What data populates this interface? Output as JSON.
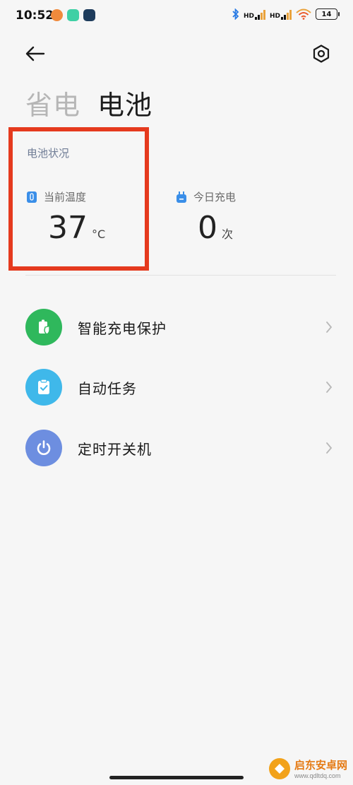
{
  "status_bar": {
    "time": "10:52",
    "left_icons": [
      "alarm-icon",
      "wechat-icon",
      "app-icon"
    ],
    "signal_1_label": "HD",
    "signal_2_label": "HD",
    "battery_level": "14"
  },
  "header": {
    "back_icon": "back-arrow-icon",
    "settings_icon": "gear-icon"
  },
  "tabs": [
    {
      "label": "省电",
      "active": false
    },
    {
      "label": "电池",
      "active": true
    }
  ],
  "battery_status": {
    "section_title": "电池状况",
    "temperature": {
      "label": "当前温度",
      "value": "37",
      "unit": "°C",
      "icon": "thermometer-icon",
      "accent": "#3a8ee8"
    },
    "charges_today": {
      "label": "今日充电",
      "value": "0",
      "unit": "次",
      "icon": "plug-icon",
      "accent": "#3a8ee8"
    }
  },
  "menu": [
    {
      "label": "智能充电保护",
      "icon": "battery-shield-icon",
      "color": "#2fb85c"
    },
    {
      "label": "自动任务",
      "icon": "clipboard-check-icon",
      "color": "#3fb8ea"
    },
    {
      "label": "定时开关机",
      "icon": "power-icon",
      "color": "#6d8ee0"
    }
  ],
  "watermark": {
    "title": "启东安卓网",
    "url": "www.qdltdq.com"
  },
  "colors": {
    "highlight_border": "#e53a1e",
    "background": "#f6f6f6"
  }
}
